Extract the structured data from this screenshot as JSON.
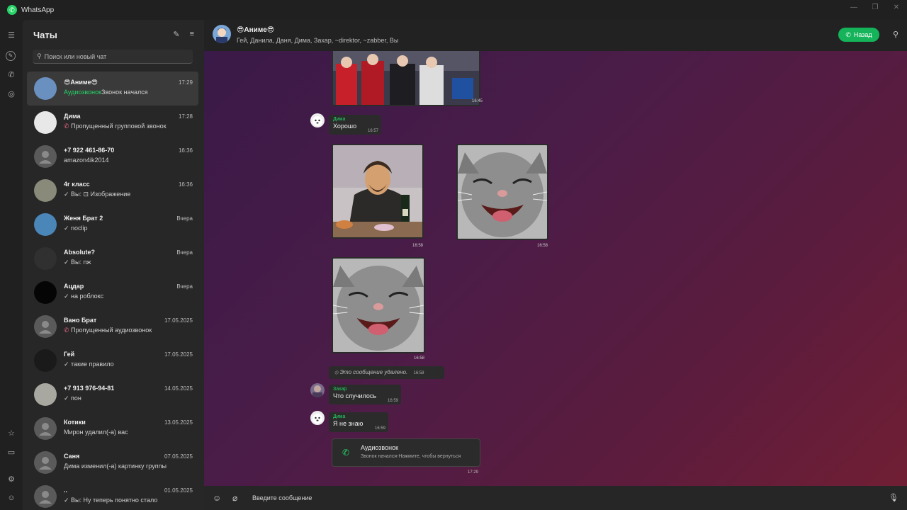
{
  "window": {
    "title": "WhatsApp"
  },
  "sidebar": {
    "title": "Чаты",
    "search_placeholder": "Поиск или новый чат",
    "chats": [
      {
        "name": "😎Аниме😎",
        "time": "17:29",
        "prefix": "Аудиозвонок",
        "preview": "Звонок начался",
        "active": true,
        "avatar_color": "#6a90c0"
      },
      {
        "name": "Дима",
        "time": "17:28",
        "prefix": "",
        "preview": "Пропущенный групповой звонок",
        "active": false,
        "avatar_color": "#e8e8e8"
      },
      {
        "name": "+7 922 461-86-70",
        "time": "16:36",
        "prefix": "",
        "preview": "amazon4ik2014",
        "active": false,
        "avatar_color": "#5a5a5a"
      },
      {
        "name": "4г класс",
        "time": "16:36",
        "prefix": "",
        "preview": "✓ Вы: ⊡ Изображение",
        "active": false,
        "avatar_color": "#8a8a7a"
      },
      {
        "name": "Женя Брат 2",
        "time": "Вчера",
        "prefix": "",
        "preview": "✓ noclip",
        "active": false,
        "avatar_color": "#4a86b8"
      },
      {
        "name": "Absolute?",
        "time": "Вчера",
        "prefix": "",
        "preview": "✓ Вы: пж",
        "active": false,
        "avatar_color": "#303030"
      },
      {
        "name": "Ацдар",
        "time": "Вчера",
        "prefix": "",
        "preview": "✓ на роблокс",
        "active": false,
        "avatar_color": "#050505"
      },
      {
        "name": "Вано Брат",
        "time": "17.05.2025",
        "prefix": "",
        "preview": "Пропущенный аудиозвонок",
        "active": false,
        "avatar_color": "#5a5a5a"
      },
      {
        "name": "Гей",
        "time": "17.05.2025",
        "prefix": "",
        "preview": "✓ такие правило",
        "active": false,
        "avatar_color": "#1a1a1a"
      },
      {
        "name": "+7 913 976-94-81",
        "time": "14.05.2025",
        "prefix": "",
        "preview": "✓ пон",
        "active": false,
        "avatar_color": "#a8a8a0"
      },
      {
        "name": "Котики",
        "time": "13.05.2025",
        "prefix": "",
        "preview": "Мирон удалил(-а) вас",
        "active": false,
        "avatar_color": "#5a5a5a"
      },
      {
        "name": "Саня",
        "time": "07.05.2025",
        "prefix": "",
        "preview": "Дима изменил(-а) картинку группы",
        "active": false,
        "avatar_color": "#5a5a5a"
      },
      {
        "name": "..",
        "time": "01.05.2025",
        "prefix": "",
        "preview": "✓ Вы: Ну теперь понятно стало",
        "active": false,
        "avatar_color": "#5a5a5a"
      }
    ]
  },
  "header": {
    "name": "😎Аниме😎",
    "members": "Гей, Данила, Даня, Дима, Захар, ~direktor, ~zabber, Вы",
    "back_label": "Назад"
  },
  "messages": {
    "photo1_time": "16:45",
    "dima1": {
      "sender": "Дима",
      "text": "Хорошо",
      "time": "16:57"
    },
    "photo2_time": "16:58",
    "photo3_time": "16:58",
    "photo4_time": "16:58",
    "deleted": {
      "text": "Это сообщение удалено.",
      "time": "16:58"
    },
    "zahar": {
      "sender": "Захар",
      "text": "Что случилось",
      "time": "16:59"
    },
    "dima2": {
      "sender": "Дима",
      "text": "Я не знаю",
      "time": "16:59"
    },
    "call": {
      "title": "Аудиозвонок",
      "subtitle": "Звонок начался-Нажмите, чтобы вернуться",
      "time": "17:29"
    }
  },
  "composer": {
    "placeholder": "Введите сообщение"
  },
  "colors": {
    "accent": "#25d366",
    "call_button": "#15b45a",
    "missed": "#e0607e"
  }
}
